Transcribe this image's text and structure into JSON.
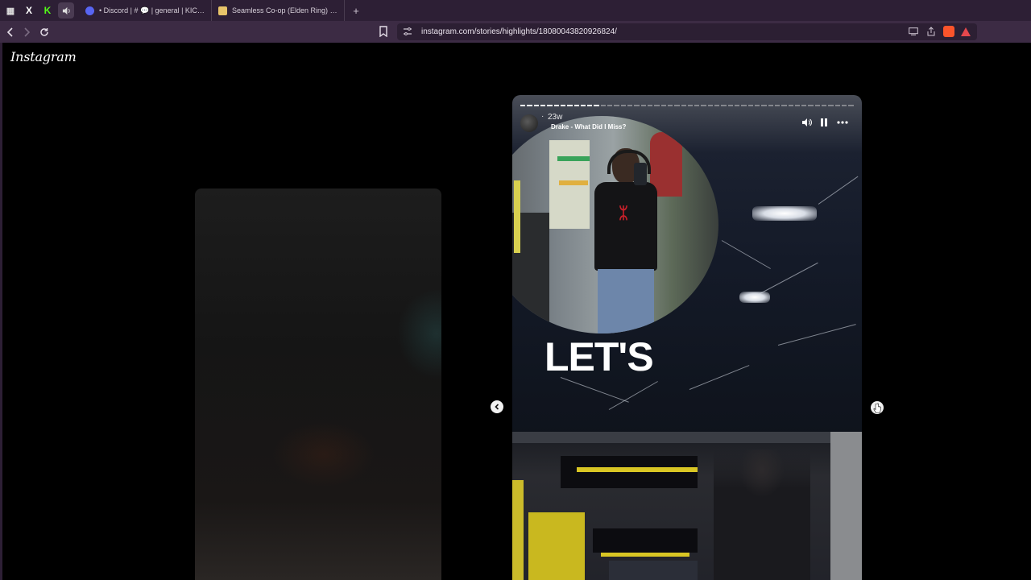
{
  "browser": {
    "pinned_tabs": [
      {
        "name": "window-menu",
        "glyph": "▦"
      },
      {
        "name": "x-tab",
        "glyph": "X"
      },
      {
        "name": "kick-tab",
        "glyph": "K"
      },
      {
        "name": "audio-tab",
        "glyph": "🔊"
      }
    ],
    "tabs": [
      {
        "title": "• Discord | # 💬 | general | KICK Strea",
        "favicon": "discord"
      },
      {
        "title": "Seamless Co-op (Elden Ring) at Elden",
        "favicon": "elden"
      }
    ],
    "new_tab_label": "+",
    "url": "instagram.com/stories/highlights/18080043820926824/"
  },
  "page": {
    "logo_text": "Instagram"
  },
  "story": {
    "time": "23w",
    "dot": "·",
    "song": "Drake - What Did I Miss?",
    "overlay_text": "LET'S",
    "progress": {
      "total": 50,
      "completed": 12
    },
    "shirt_logo": "ᛯ"
  },
  "icons": {
    "back": "chevron-left-icon",
    "forward": "chevron-right-icon",
    "reload": "reload-icon",
    "bookmark": "bookmark-icon",
    "site_info": "site-info-icon",
    "mute": "speaker-icon",
    "pause": "pause-icon",
    "more": "more-icon"
  }
}
